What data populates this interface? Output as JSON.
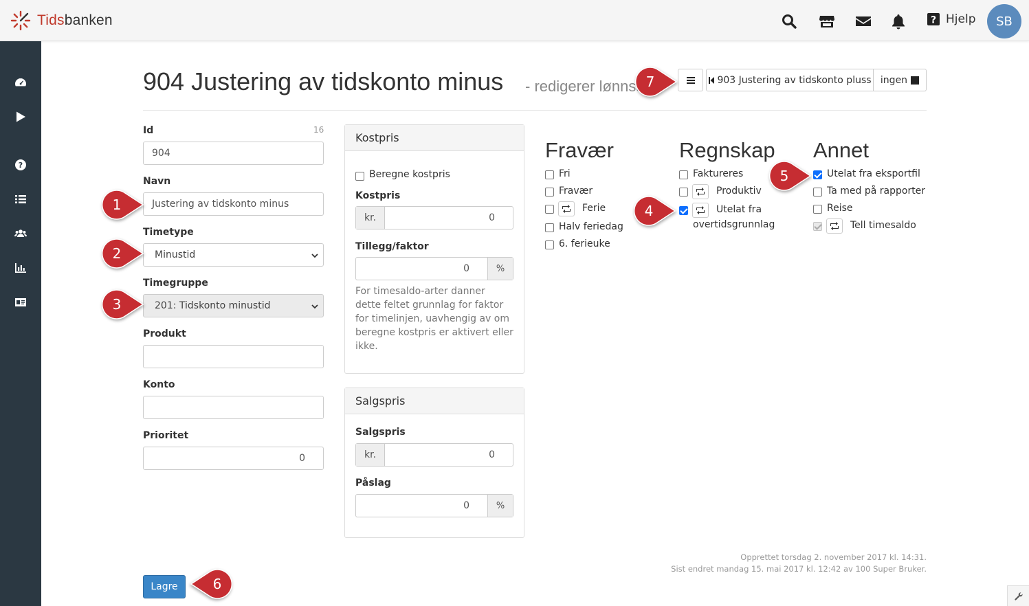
{
  "header": {
    "logo_prefix": "Tids",
    "logo_suffix": "banken",
    "help_label": "Hjelp",
    "avatar_initials": "SB"
  },
  "page": {
    "title": "904 Justering av tidskonto minus",
    "subtitle": "- redigerer lønnsart",
    "menu_button_icon": "menu-icon",
    "prev_label": "903 Justering av tidskonto pluss",
    "next_label": "ingen"
  },
  "form": {
    "id_label": "Id",
    "id_count": "16",
    "id_value": "904",
    "navn_label": "Navn",
    "navn_value": "Justering av tidskonto minus",
    "timetype_label": "Timetype",
    "timetype_value": "Minustid",
    "timegruppe_label": "Timegruppe",
    "timegruppe_value": "201: Tidskonto minustid",
    "produkt_label": "Produkt",
    "produkt_value": "",
    "konto_label": "Konto",
    "konto_value": "",
    "prioritet_label": "Prioritet",
    "prioritet_value": "0"
  },
  "kostpris": {
    "title": "Kostpris",
    "beregne_label": "Beregne kostpris",
    "kostpris_label": "Kostpris",
    "currency": "kr.",
    "kostpris_value": "0",
    "tillegg_label": "Tillegg/faktor",
    "tillegg_value": "0",
    "percent": "%",
    "help": "For timesaldo-arter danner dette feltet grunnlag for faktor for timelinjen, uavhengig av om beregne kostpris er aktivert eller ikke."
  },
  "salgspris": {
    "title": "Salgspris",
    "salgspris_label": "Salgspris",
    "currency": "kr.",
    "salgspris_value": "0",
    "paslag_label": "Påslag",
    "paslag_value": "0",
    "percent": "%"
  },
  "fravaer": {
    "title": "Fravær",
    "items": [
      "Fri",
      "Fravær",
      "Ferie",
      "Halv feriedag",
      "6. ferieuke"
    ]
  },
  "regnskap": {
    "title": "Regnskap",
    "items": [
      "Faktureres",
      "Produktiv",
      "Utelat fra",
      "overtidsgrunnlag"
    ]
  },
  "annet": {
    "title": "Annet",
    "items": [
      "Utelat fra eksportfil",
      "Ta med på rapporter",
      "Reise",
      "Tell timesaldo"
    ]
  },
  "footer": {
    "created": "Opprettet torsdag 2. november 2017 kl. 14:31.",
    "modified": "Sist endret mandag 15. mai 2017 kl. 12:42 av 100 Super Bruker.",
    "save_label": "Lagre"
  },
  "markers": [
    "1",
    "2",
    "3",
    "4",
    "5",
    "6",
    "7"
  ],
  "colors": {
    "sidebar": "#2b3842",
    "primary": "#3a86c8",
    "marker": "#c62d32",
    "checkbox": "#0d6efd"
  }
}
